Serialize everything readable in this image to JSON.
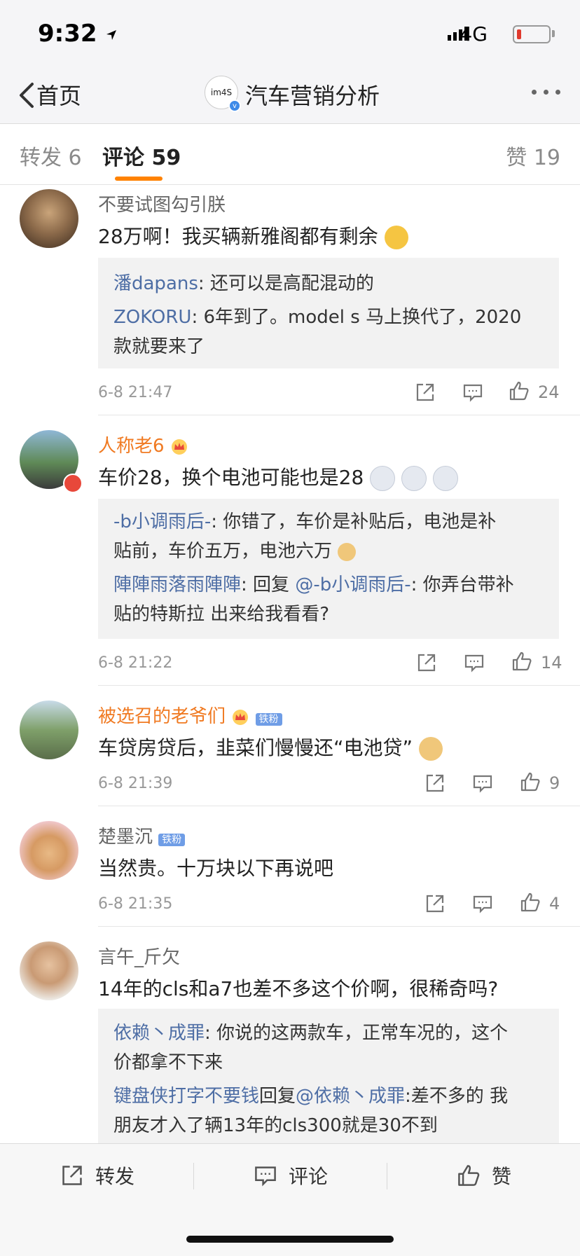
{
  "status": {
    "time": "9:32",
    "network": "4G"
  },
  "nav": {
    "back_label": "首页",
    "avatar_text": "im4S",
    "title": "汽车营销分析"
  },
  "tabs": {
    "repost": "转发 6",
    "comments": "评论 59",
    "likes": "赞 19"
  },
  "comments": [
    {
      "user": "不要试图勾引朕",
      "text": "28万啊！我买辆新雅阁都有剩余",
      "replies": [
        {
          "name": "潘dapans",
          "text": ": 还可以是高配混动的"
        },
        {
          "name": "ZOKORU",
          "text": ": 6年到了。model s 马上换代了，2020",
          "cont": "款就要来了"
        }
      ],
      "time": "6-8 21:47",
      "likes": "24"
    },
    {
      "user": "人称老6",
      "text": "车价28，换个电池可能也是28",
      "replies": [
        {
          "name": "-b小调雨后-",
          "text": ": 你错了，车价是补贴后，电池是补",
          "cont": "贴前，车价五万，电池六万"
        },
        {
          "name": "陣陣雨落雨陣陣",
          "text": ": 回复 ",
          "mention": "@-b小调雨后-",
          "text2": ": 你弄台带补",
          "cont": "贴的特斯拉 出来给我看看?"
        }
      ],
      "time": "6-8 21:22",
      "likes": "14"
    },
    {
      "user": "被选召的老爷们",
      "badge": "铁粉",
      "text": "车贷房贷后，韭菜们慢慢还“电池贷”",
      "time": "6-8 21:39",
      "likes": "9"
    },
    {
      "user": "楚墨沉",
      "badge": "铁粉",
      "text": "当然贵。十万块以下再说吧",
      "time": "6-8 21:35",
      "likes": "4"
    },
    {
      "user": "言午_斤欠",
      "text": "14年的cls和a7也差不多这个价啊，很稀奇吗?",
      "replies": [
        {
          "name": "依赖丶成罪",
          "text": ": 你说的这两款车，正常车况的，这个",
          "cont": "价都拿不下来"
        },
        {
          "name": "键盘侠打字不要钱",
          "text": "回复",
          "mention": "@依赖丶成罪",
          "text2": ":差不多的 我",
          "cont": "朋友才入了辆13年的cls300就是30不到"
        }
      ]
    }
  ],
  "bottom": {
    "repost": "转发",
    "comment": "评论",
    "like": "赞"
  }
}
